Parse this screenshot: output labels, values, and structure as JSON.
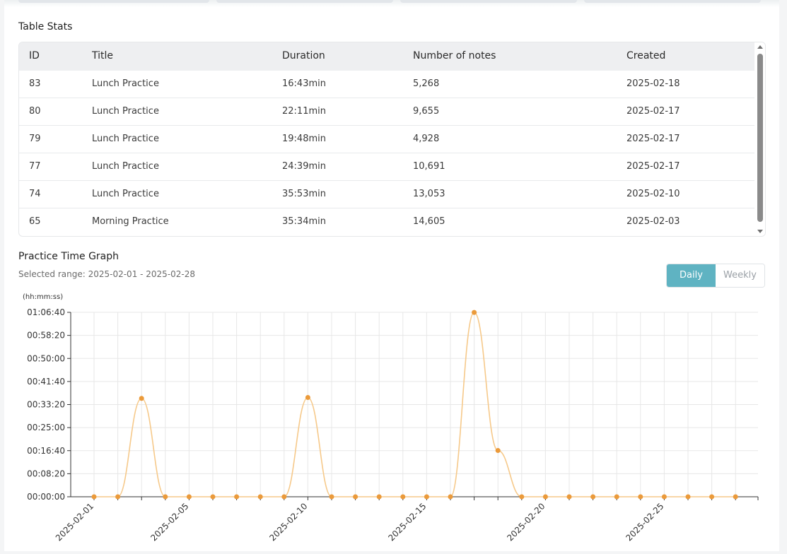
{
  "table_section": {
    "title": "Table Stats",
    "columns": [
      "ID",
      "Title",
      "Duration",
      "Number of notes",
      "Created"
    ],
    "rows": [
      {
        "id": "83",
        "title": "Lunch Practice",
        "duration": "16:43min",
        "notes": "5,268",
        "created": "2025-02-18"
      },
      {
        "id": "80",
        "title": "Lunch Practice",
        "duration": "22:11min",
        "notes": "9,655",
        "created": "2025-02-17"
      },
      {
        "id": "79",
        "title": "Lunch Practice",
        "duration": "19:48min",
        "notes": "4,928",
        "created": "2025-02-17"
      },
      {
        "id": "77",
        "title": "Lunch Practice",
        "duration": "24:39min",
        "notes": "10,691",
        "created": "2025-02-17"
      },
      {
        "id": "74",
        "title": "Lunch Practice",
        "duration": "35:53min",
        "notes": "13,053",
        "created": "2025-02-10"
      },
      {
        "id": "65",
        "title": "Morning Practice",
        "duration": "35:34min",
        "notes": "14,605",
        "created": "2025-02-03"
      }
    ]
  },
  "graph_section": {
    "title": "Practice Time Graph",
    "selected_range": "Selected range: 2025-02-01 - 2025-02-28",
    "toggle": {
      "daily": "Daily",
      "weekly": "Weekly",
      "active": "Daily"
    }
  },
  "chart_data": {
    "type": "line",
    "ylabel": "(hh:mm:ss)",
    "ylim": [
      0,
      4000
    ],
    "y_ticks": [
      "00:00:00",
      "00:08:20",
      "00:16:40",
      "00:25:00",
      "00:33:20",
      "00:41:40",
      "00:50:00",
      "00:58:20",
      "01:06:40"
    ],
    "x_tick_labels": [
      "2025-02-01",
      "2025-02-05",
      "2025-02-10",
      "2025-02-15",
      "2025-02-20",
      "2025-02-25"
    ],
    "x": [
      "2025-02-01",
      "2025-02-02",
      "2025-02-03",
      "2025-02-04",
      "2025-02-05",
      "2025-02-06",
      "2025-02-07",
      "2025-02-08",
      "2025-02-09",
      "2025-02-10",
      "2025-02-11",
      "2025-02-12",
      "2025-02-13",
      "2025-02-14",
      "2025-02-15",
      "2025-02-16",
      "2025-02-17",
      "2025-02-18",
      "2025-02-19",
      "2025-02-20",
      "2025-02-21",
      "2025-02-22",
      "2025-02-23",
      "2025-02-24",
      "2025-02-25",
      "2025-02-26",
      "2025-02-27",
      "2025-02-28"
    ],
    "series": [
      {
        "values": [
          0,
          0,
          2134,
          0,
          0,
          0,
          0,
          0,
          0,
          2153,
          0,
          0,
          0,
          0,
          0,
          0,
          3998,
          1003,
          0,
          0,
          0,
          0,
          0,
          0,
          0,
          0,
          0,
          0
        ]
      }
    ],
    "colors": {
      "line": "#f6c98a",
      "point": "#eb9a3a",
      "grid": "#e7e7e7",
      "axis": "#333333"
    },
    "grid": true
  }
}
